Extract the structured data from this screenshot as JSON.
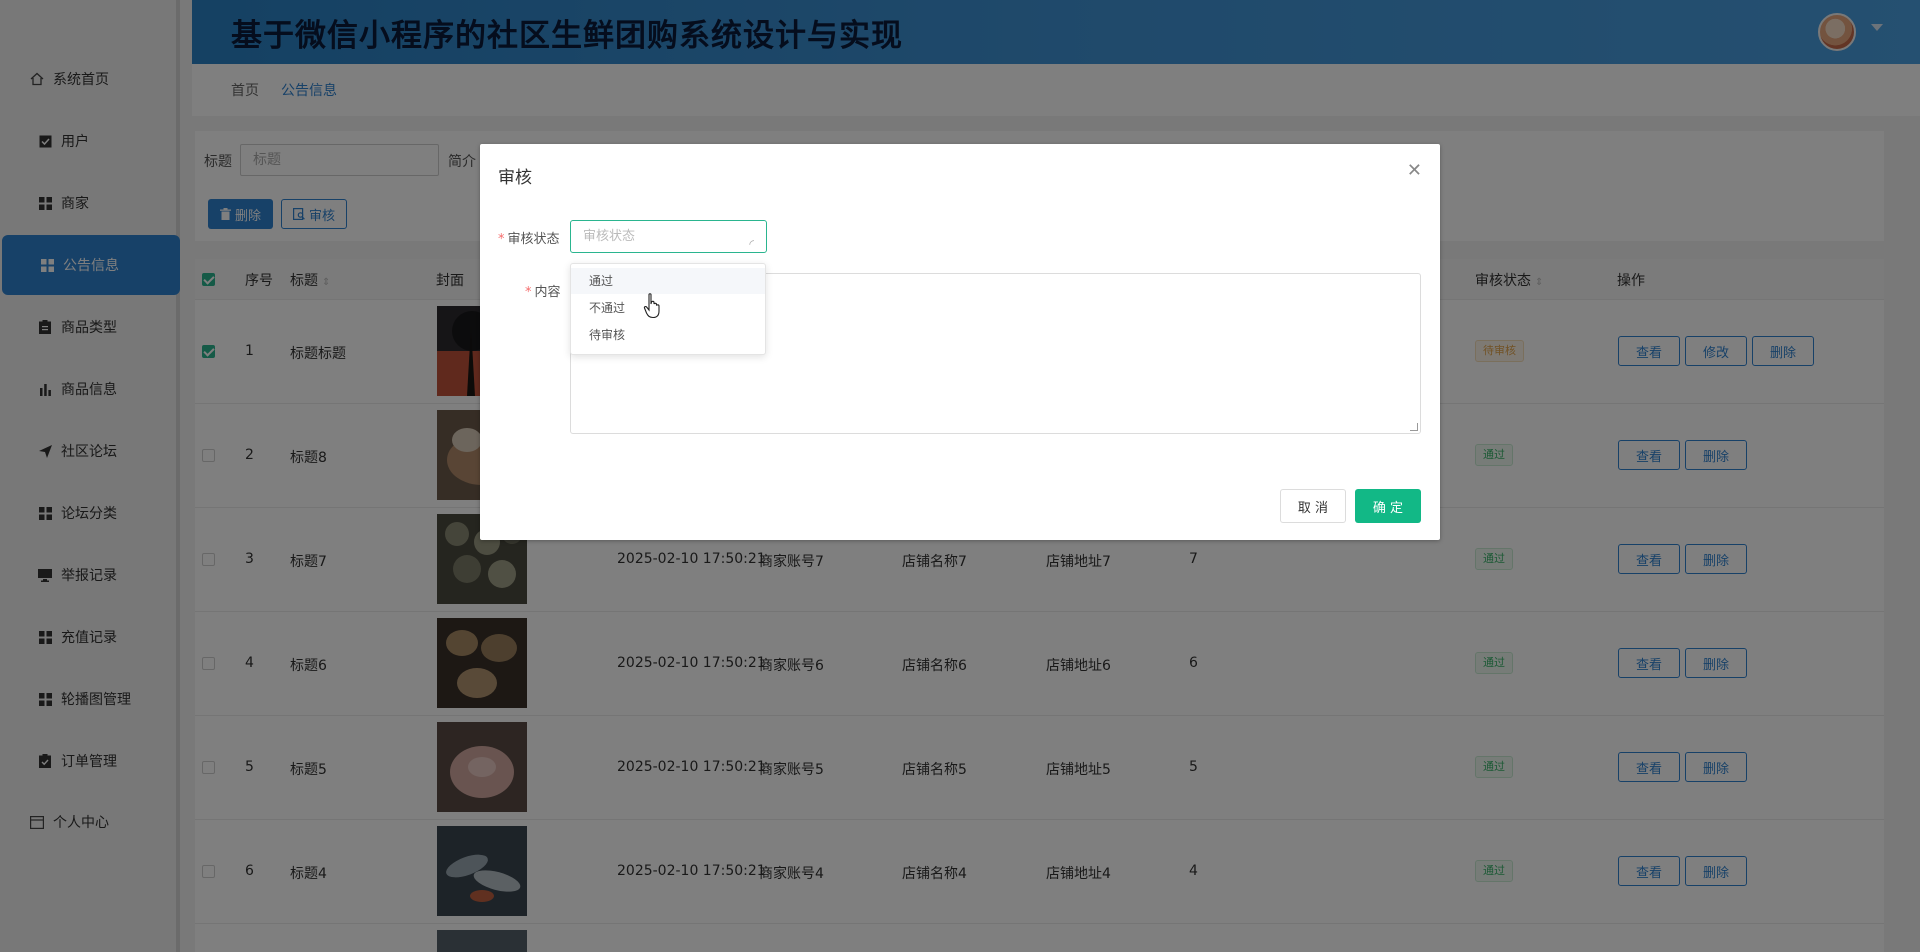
{
  "app": {
    "title": "基于微信小程序的社区生鲜团购系统设计与实现"
  },
  "sidebar": {
    "items": [
      {
        "label": "系统首页",
        "icon": "home-icon"
      },
      {
        "label": "用户",
        "icon": "check-square-icon"
      },
      {
        "label": "商家",
        "icon": "grid-icon"
      },
      {
        "label": "公告信息",
        "icon": "grid-icon",
        "active": true
      },
      {
        "label": "商品类型",
        "icon": "clipboard-icon"
      },
      {
        "label": "商品信息",
        "icon": "bar-chart-icon"
      },
      {
        "label": "社区论坛",
        "icon": "send-icon"
      },
      {
        "label": "论坛分类",
        "icon": "grid-icon"
      },
      {
        "label": "举报记录",
        "icon": "monitor-icon"
      },
      {
        "label": "充值记录",
        "icon": "grid-icon"
      },
      {
        "label": "轮播图管理",
        "icon": "grid-icon"
      },
      {
        "label": "订单管理",
        "icon": "clipboard-check-icon"
      },
      {
        "label": "个人中心",
        "icon": "card-icon"
      }
    ]
  },
  "breadcrumb": {
    "home": "首页",
    "current": "公告信息"
  },
  "search": {
    "title_label": "标题",
    "title_placeholder": "标题",
    "intro_label": "简介"
  },
  "toolbar": {
    "delete_label": "删除",
    "audit_label": "审核"
  },
  "table": {
    "headers": {
      "index": "序号",
      "title": "标题",
      "cover": "封面",
      "audit_status": "审核状态",
      "actions": "操作"
    },
    "rows": [
      {
        "index": "1",
        "title": "标题标题",
        "time": "",
        "account": "",
        "shop": "",
        "address": "",
        "num": "",
        "status": "待审核",
        "status_type": "wait",
        "checked": true,
        "actions": [
          "查看",
          "修改",
          "删除"
        ]
      },
      {
        "index": "2",
        "title": "标题8",
        "time": "",
        "account": "",
        "shop": "",
        "address": "",
        "num": "",
        "status": "通过",
        "status_type": "ok",
        "checked": false,
        "actions": [
          "查看",
          "删除"
        ]
      },
      {
        "index": "3",
        "title": "标题7",
        "time": "2025-02-10 17:50:21",
        "account": "商家账号7",
        "shop": "店铺名称7",
        "address": "店铺地址7",
        "num": "7",
        "status": "通过",
        "status_type": "ok",
        "checked": false,
        "actions": [
          "查看",
          "删除"
        ]
      },
      {
        "index": "4",
        "title": "标题6",
        "time": "2025-02-10 17:50:21",
        "account": "商家账号6",
        "shop": "店铺名称6",
        "address": "店铺地址6",
        "num": "6",
        "status": "通过",
        "status_type": "ok",
        "checked": false,
        "actions": [
          "查看",
          "删除"
        ]
      },
      {
        "index": "5",
        "title": "标题5",
        "time": "2025-02-10 17:50:21",
        "account": "商家账号5",
        "shop": "店铺名称5",
        "address": "店铺地址5",
        "num": "5",
        "status": "通过",
        "status_type": "ok",
        "checked": false,
        "actions": [
          "查看",
          "删除"
        ]
      },
      {
        "index": "6",
        "title": "标题4",
        "time": "2025-02-10 17:50:21",
        "account": "商家账号4",
        "shop": "店铺名称4",
        "address": "店铺地址4",
        "num": "4",
        "status": "通过",
        "status_type": "ok",
        "checked": false,
        "actions": [
          "查看",
          "删除"
        ]
      }
    ]
  },
  "dialog": {
    "title": "审核",
    "status_label": "审核状态",
    "status_placeholder": "审核状态",
    "content_label": "内容",
    "cancel_label": "取 消",
    "confirm_label": "确 定",
    "options": [
      "通过",
      "不通过",
      "待审核"
    ]
  },
  "colors": {
    "primary": "#2f82d1",
    "accent": "#12b886",
    "header_start": "#2a82c6",
    "header_end": "#4aa0e2"
  }
}
